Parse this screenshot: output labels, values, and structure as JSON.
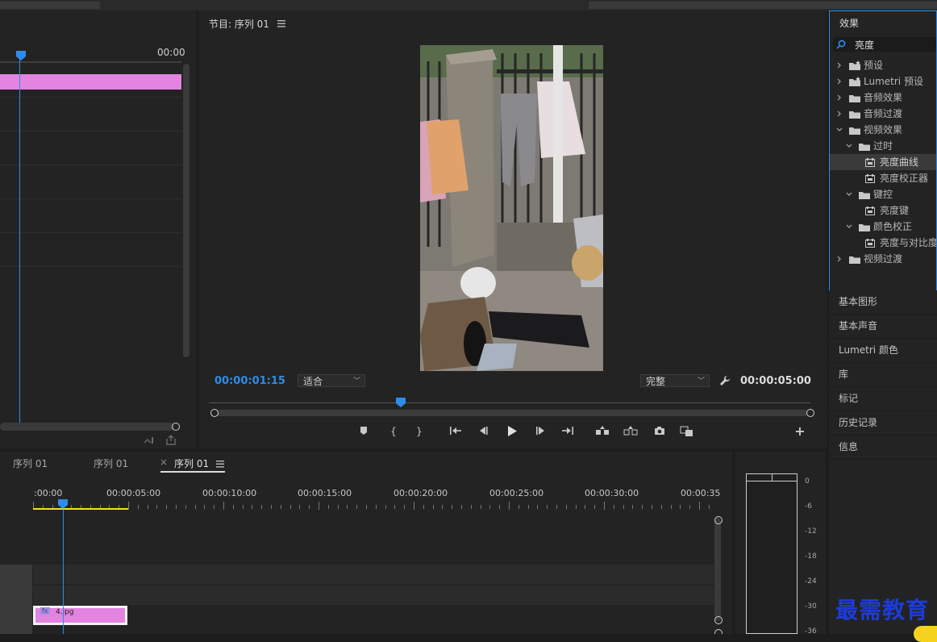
{
  "program": {
    "title": "节目: 序列 01",
    "timecode_current": "00:00:01:15",
    "timecode_duration": "00:00:05:00",
    "zoom_select": "适合",
    "quality_select": "完整"
  },
  "source": {
    "ruler_time": "00:00"
  },
  "effects": {
    "tab_label": "效果",
    "search_value": "亮度",
    "tree": [
      {
        "label": "预设",
        "type": "folder-special",
        "expanded": false
      },
      {
        "label": "Lumetri 预设",
        "type": "folder-special",
        "expanded": false
      },
      {
        "label": "音频效果",
        "type": "folder",
        "expanded": false
      },
      {
        "label": "音频过渡",
        "type": "folder",
        "expanded": false
      },
      {
        "label": "视频效果",
        "type": "folder",
        "expanded": true
      },
      {
        "label": "过时",
        "type": "folder",
        "expanded": true
      },
      {
        "label": "亮度曲线",
        "type": "effect",
        "selected": true
      },
      {
        "label": "亮度校正器",
        "type": "effect"
      },
      {
        "label": "键控",
        "type": "folder",
        "expanded": true
      },
      {
        "label": "亮度键",
        "type": "effect"
      },
      {
        "label": "颜色校正",
        "type": "folder",
        "expanded": true
      },
      {
        "label": "亮度与对比度",
        "type": "effect"
      },
      {
        "label": "视频过渡",
        "type": "folder",
        "expanded": false
      }
    ]
  },
  "side_panels": [
    "基本图形",
    "基本声音",
    "Lumetri 颜色",
    "库",
    "标记",
    "历史记录",
    "信息"
  ],
  "timeline": {
    "tabs": [
      "序列 01",
      "序列 01",
      "序列 01"
    ],
    "active_tab_index": 2,
    "ruler": [
      ":00:00",
      "00:00:05:00",
      "00:00:10:00",
      "00:00:15:00",
      "00:00:20:00",
      "00:00:25:00",
      "00:00:30:00",
      "00:00:35"
    ],
    "clip_name": "4.jpg",
    "clip_badge": "fx"
  },
  "meter": {
    "db": [
      "0",
      "-6",
      "-12",
      "-18",
      "-24",
      "-30",
      "-36"
    ]
  },
  "watermark": "最需教育",
  "colors": {
    "accent_blue": "#2d8ceb",
    "clip_pink": "#e284e0",
    "work_area_yellow": "#f1e31c"
  }
}
